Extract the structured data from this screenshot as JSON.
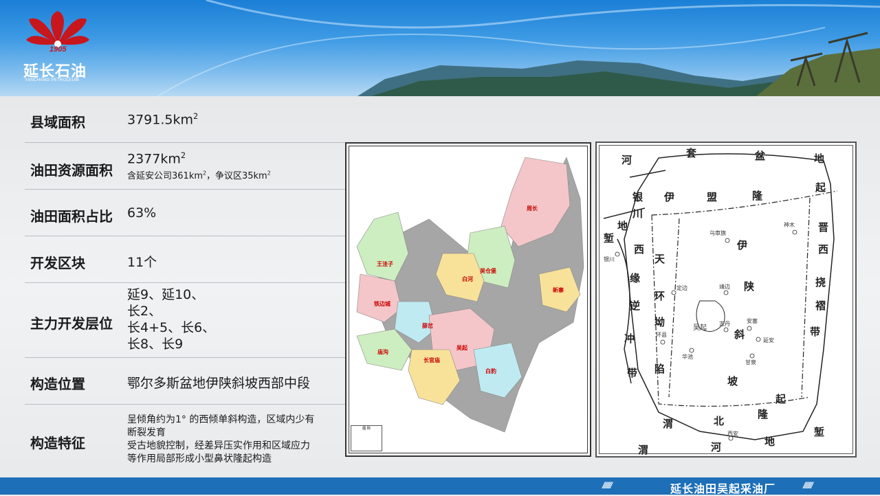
{
  "brand": {
    "year": "1905",
    "name_cn": "延长石油",
    "name_en": "YANCHANG PETROLEUM",
    "colors": {
      "logo_red": "#c8161d",
      "header_blue": "#1b7fd6",
      "footer_blue": "#1d6fb8"
    }
  },
  "rows": [
    {
      "label": "县域面积",
      "value": "3791.5km",
      "sup": "2"
    },
    {
      "label": "油田资源面积",
      "value": "2377km",
      "sup": "2",
      "note_a": "含延安公司361km",
      "note_sup_a": "2",
      "note_b": "，争议区35km",
      "note_sup_b": "2"
    },
    {
      "label": "油田面积占比",
      "value": "63%"
    },
    {
      "label": "开发区块",
      "value": "11个"
    },
    {
      "label": "主力开发层位",
      "lines": [
        "延9、延10、",
        "长2、",
        "长4+5、长6、",
        "长8、长9"
      ]
    },
    {
      "label": "构造位置",
      "value": "鄂尔多斯盆地伊陕斜坡西部中段"
    },
    {
      "label": "构造特征",
      "lines": [
        "呈倾角约为1° 的西倾单斜构造，区域内少有",
        "断裂发育",
        "受古地貌控制，经差异压实作用和区域应力",
        "等作用局部形成小型鼻状隆起构造"
      ]
    }
  ],
  "map_county": {
    "labels": [
      "周长",
      "王洼子",
      "吴仓堡",
      "白河",
      "铁边城",
      "薛岔",
      "庙沟",
      "长官庙",
      "吴起",
      "白豹",
      "新寨"
    ],
    "legend": "图 例"
  },
  "map_basin": {
    "region_labels": [
      "河",
      "套",
      "盆",
      "地",
      "起",
      "伊",
      "盟",
      "隆",
      "银",
      "川",
      "地",
      "堑",
      "西",
      "缘",
      "逆",
      "冲",
      "带",
      "天",
      "环",
      "坳",
      "陷",
      "伊",
      "陕",
      "斜",
      "坡",
      "晋",
      "西",
      "挠",
      "褶",
      "带",
      "渭",
      "北",
      "隆",
      "起",
      "渭",
      "河",
      "地",
      "堑"
    ],
    "city_labels": [
      "神木",
      "乌审旗",
      "银川",
      "定边",
      "靖边",
      "吴起",
      "志丹",
      "安塞",
      "延安",
      "环县",
      "华池",
      "甘泉",
      "西安"
    ]
  },
  "footer": {
    "text": "延长油田吴起采油厂",
    "stripes": "////////"
  }
}
